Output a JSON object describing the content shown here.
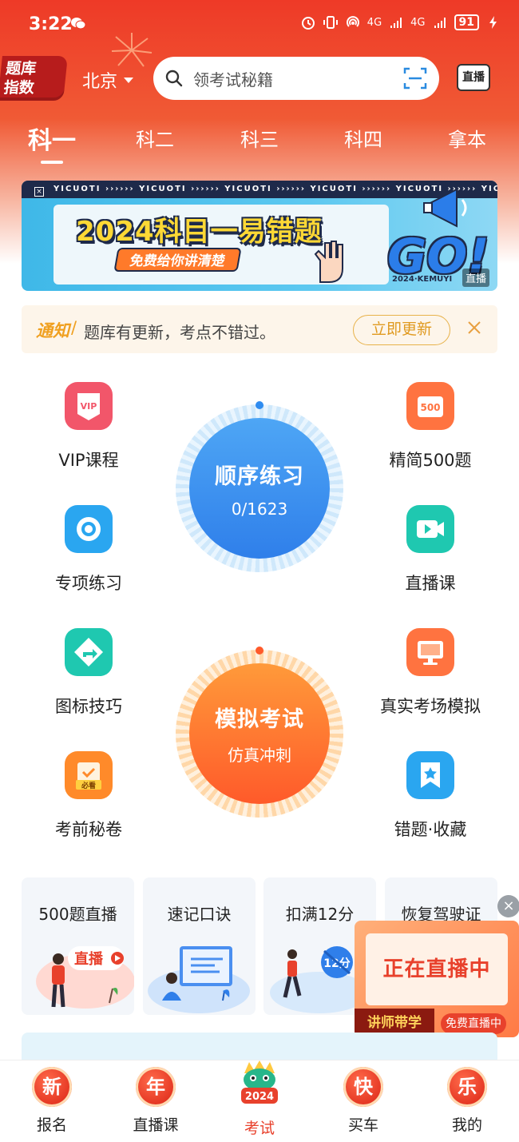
{
  "status_bar": {
    "time": "3:22",
    "network_left": "4G",
    "network_right": "4G",
    "battery": "91"
  },
  "header": {
    "logo_line1": "题库",
    "logo_line2": "指数",
    "city": "北京",
    "search_placeholder": "领考试秘籍",
    "live_label": "直播"
  },
  "subject_tabs": [
    {
      "label": "科一",
      "active": true
    },
    {
      "label": "科二",
      "active": false
    },
    {
      "label": "科三",
      "active": false
    },
    {
      "label": "科四",
      "active": false
    },
    {
      "label": "拿本",
      "active": false
    }
  ],
  "banner": {
    "strip_text": "YICUOTI ›››››› YICUOTI ›››››› YICUOTI ›››››› YICUOTI ›››››› YICUOTI ›››››› YICUOTI",
    "title": "2024科目一易错题",
    "subtitle": "免费给你讲清楚",
    "go_text": "GO!",
    "year_tag": "2024·KEMUYI",
    "live_tag": "直播"
  },
  "notice": {
    "tag": "通知",
    "slash": "/",
    "text": "题库有更新，考点不错过。",
    "button": "立即更新"
  },
  "features_left": [
    {
      "label": "VIP课程",
      "icon": "vip-icon",
      "color": "#f2566a"
    },
    {
      "label": "专项练习",
      "icon": "target-icon",
      "color": "#2aa6f0"
    },
    {
      "label": "图标技巧",
      "icon": "road-sign-icon",
      "color": "#1fc8b0"
    },
    {
      "label": "考前秘卷",
      "icon": "exam-paper-icon",
      "color": "#ff8a2a"
    }
  ],
  "features_right": [
    {
      "label": "精简500题",
      "icon": "500-icon",
      "color": "#ff7340"
    },
    {
      "label": "直播课",
      "icon": "video-icon",
      "color": "#1fc8b0"
    },
    {
      "label": "真实考场模拟",
      "icon": "monitor-icon",
      "color": "#ff7340"
    },
    {
      "label": "错题·收藏",
      "icon": "bookmark-star-icon",
      "color": "#2aa6f0"
    }
  ],
  "sequential_practice": {
    "title": "顺序练习",
    "progress": "0/1623",
    "done": 0,
    "total": 1623
  },
  "mock_exam": {
    "title": "模拟考试",
    "subtitle": "仿真冲刺"
  },
  "cards": [
    {
      "title": "500题直播",
      "badge": "直播"
    },
    {
      "title": "速记口诀"
    },
    {
      "title": "扣满12分",
      "badge": "12分"
    },
    {
      "title": "恢复驾驶证"
    }
  ],
  "live_float": {
    "title": "正在直播中",
    "left_label": "讲师带学",
    "right_label": "免费直播中",
    "close": "×"
  },
  "tabbar": [
    {
      "label": "报名",
      "icon_text": "新",
      "active": false
    },
    {
      "label": "直播课",
      "icon_text": "年",
      "active": false
    },
    {
      "label": "考试",
      "icon_text": "2024",
      "active": true
    },
    {
      "label": "买车",
      "icon_text": "快",
      "active": false
    },
    {
      "label": "我的",
      "icon_text": "乐",
      "active": false
    }
  ],
  "colors": {
    "brand_red": "#ee3a27",
    "practice_blue": "#2f8cf0",
    "exam_orange": "#ff5a2a",
    "notice_orange": "#f0a020"
  }
}
